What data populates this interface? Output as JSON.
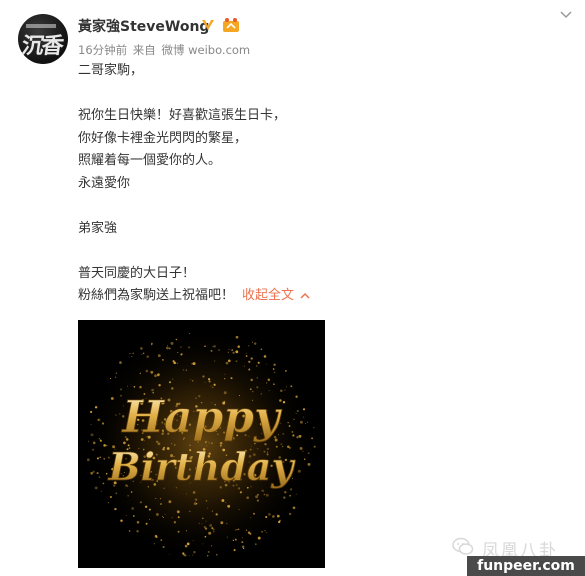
{
  "header": {
    "username": "黃家強SteveWong",
    "meta_time": "16分钟前",
    "meta_from": "来自",
    "meta_source": "微博 weibo.com",
    "avatar_text": "沉香"
  },
  "post": {
    "line1": "二哥家駒，",
    "line2": "祝你生日快樂！好喜歡這張生日卡，",
    "line3": "你好像卡裡金光閃閃的繁星，",
    "line4": "照耀着每一個愛你的人。",
    "line5": "永遠愛你",
    "line6": "弟家強",
    "line7": "普天同慶的大日子！",
    "line8": "粉絲們為家駒送上祝福吧！",
    "collapse_label": "收起全文"
  },
  "image": {
    "word1": "Happy",
    "word2": "Birthday"
  },
  "watermark": {
    "text": "凤凰八卦",
    "site": "funpeer.com"
  },
  "colors": {
    "link": "#eb7350",
    "verified": "#f5a623",
    "gold": "#d4a23a"
  }
}
